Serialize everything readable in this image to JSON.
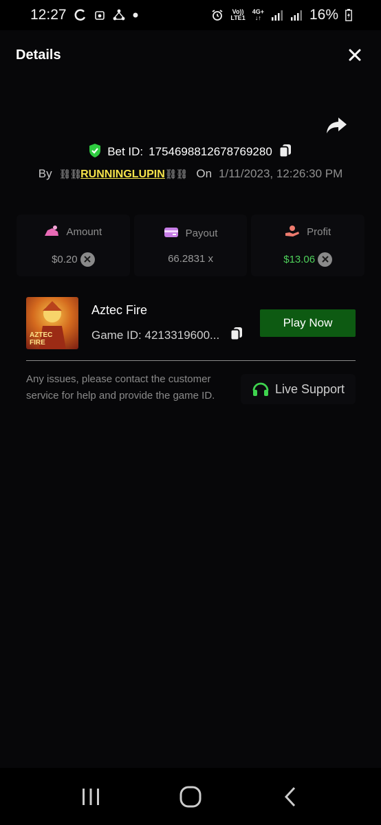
{
  "status_bar": {
    "time": "12:27",
    "volte_label": "Vo))",
    "lte_label": "LTE1",
    "network_label": "4G+",
    "battery": "16%"
  },
  "header": {
    "title": "Details"
  },
  "bet": {
    "bet_id_label": "Bet ID:",
    "bet_id": "1754698812678769280",
    "by_label": "By",
    "chain_left": "⛓⛓",
    "username": "RUNNINGLUPIN",
    "chain_right": "⛓⛓",
    "on_label": "On",
    "date": "1/11/2023, 12:26:30 PM"
  },
  "stats": {
    "amount": {
      "label": "Amount",
      "value": "$0.20"
    },
    "payout": {
      "label": "Payout",
      "value": "66.2831 x"
    },
    "profit": {
      "label": "Profit",
      "value": "$13.06"
    }
  },
  "game": {
    "name": "Aztec Fire",
    "thumb_title_line1": "AZTEC",
    "thumb_title_line2": "FIRE",
    "game_id_label": "Game ID:",
    "game_id": "4213319600...",
    "play_label": "Play Now"
  },
  "support": {
    "text": "Any issues, please contact the customer service for help and provide the game ID.",
    "button_label": "Live Support"
  },
  "colors": {
    "background": "#000000",
    "panel": "#070709",
    "username": "#f6e34a",
    "profit": "#4ed05a",
    "play_button": "#0d5a12",
    "shield": "#2ecc40"
  }
}
